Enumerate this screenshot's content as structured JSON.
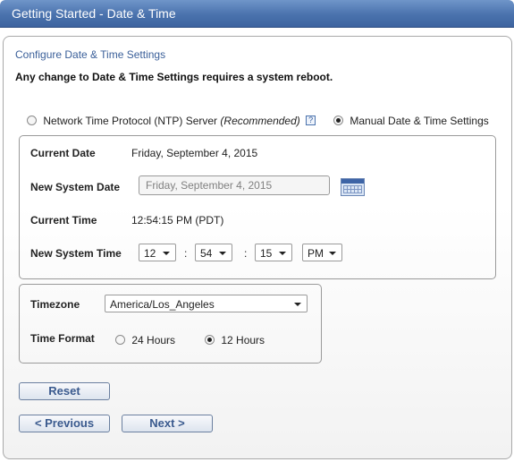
{
  "window": {
    "title": "Getting Started - Date & Time"
  },
  "header": {
    "section_title": "Configure Date & Time Settings",
    "warning": "Any change to Date & Time Settings requires a system reboot."
  },
  "mode": {
    "ntp_label": "Network Time Protocol (NTP) Server",
    "ntp_recommended": "(Recommended)",
    "help_glyph": "?",
    "manual_label": "Manual Date & Time Settings",
    "selected": "manual"
  },
  "datetime": {
    "current_date_label": "Current Date",
    "current_date_value": "Friday, September 4, 2015",
    "new_date_label": "New System Date",
    "new_date_placeholder": "Friday, September 4, 2015",
    "current_time_label": "Current Time",
    "current_time_value": "12:54:15 PM (PDT)",
    "new_time_label": "New System Time",
    "hour": "12",
    "minute": "54",
    "second": "15",
    "ampm": "PM",
    "separator": ":"
  },
  "timezone": {
    "label": "Timezone",
    "value": "America/Los_Angeles",
    "format_label": "Time Format",
    "option_24": "24 Hours",
    "option_12": "12 Hours",
    "selected_format": "12"
  },
  "buttons": {
    "reset": "Reset",
    "previous": "< Previous",
    "next": "Next >"
  }
}
